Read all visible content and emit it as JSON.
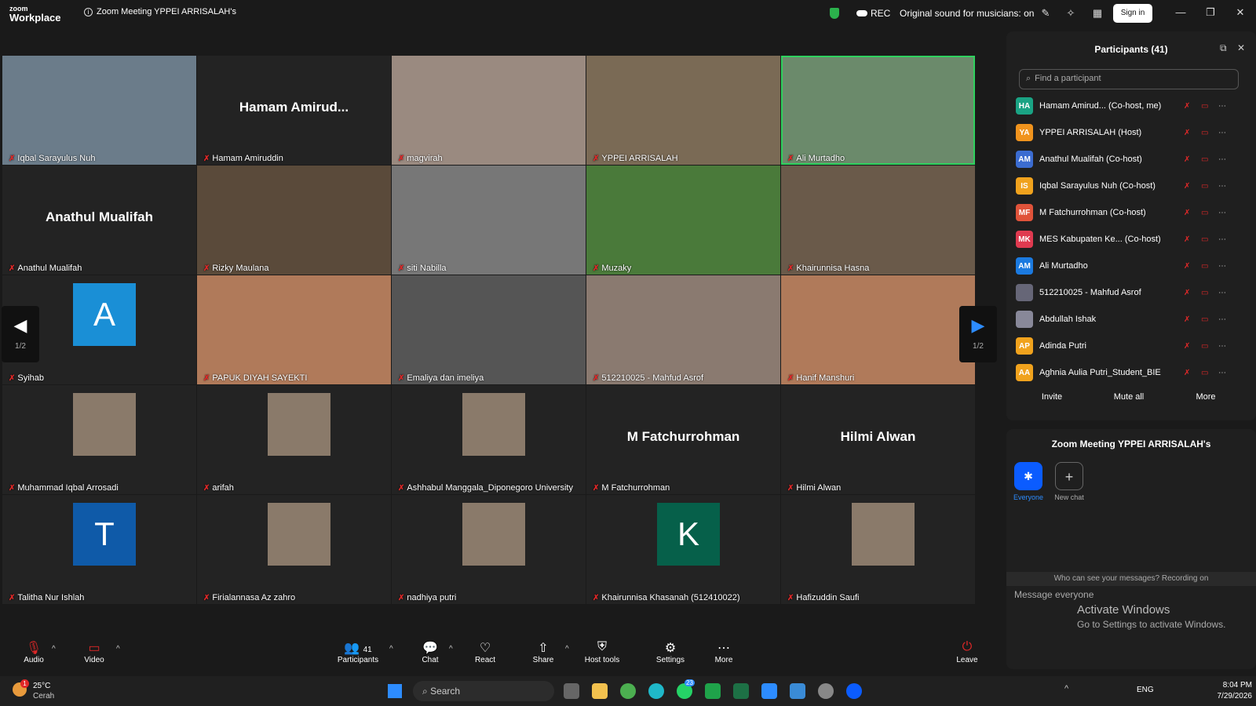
{
  "app": {
    "brand_top": "zoom",
    "brand_bottom": "Workplace",
    "meeting_title": "Zoom Meeting YPPEI ARRISALAH's",
    "rec": "REC",
    "sound": "Original sound for musicians: on",
    "signin": "Sign in"
  },
  "tiles": [
    {
      "name": "Iqbal Sarayulus Nuh",
      "type": "video"
    },
    {
      "name": "Hamam Amiruddin",
      "type": "text",
      "big": "Hamam  Amirud..."
    },
    {
      "name": "magvirah",
      "type": "video"
    },
    {
      "name": "YPPEI ARRISALAH",
      "type": "video"
    },
    {
      "name": "Ali Murtadho",
      "type": "video"
    },
    {
      "name": "Anathul Mualifah",
      "type": "text",
      "big": "Anathul Mualifah"
    },
    {
      "name": "Rizky Maulana",
      "type": "video"
    },
    {
      "name": "siti Nabilla",
      "type": "video"
    },
    {
      "name": "Muzaky",
      "type": "video"
    },
    {
      "name": "Khairunnisa Hasna",
      "type": "video"
    },
    {
      "name": "Syihab",
      "type": "avatar",
      "letter": "A"
    },
    {
      "name": "PAPUK DIYAH SAYEKTI",
      "type": "video"
    },
    {
      "name": "Emaliya dan imeliya",
      "type": "video"
    },
    {
      "name": "512210025 - Mahfud Asrof",
      "type": "video"
    },
    {
      "name": "Hanif Manshuri",
      "type": "video"
    },
    {
      "name": "Muhammad Iqbal Arrosadi",
      "type": "photo"
    },
    {
      "name": "arifah",
      "type": "photo"
    },
    {
      "name": "Ashhabul Manggala_Diponegoro University",
      "type": "photo"
    },
    {
      "name": "M Fatchurrohman",
      "type": "text",
      "big": "M Fatchurrohman"
    },
    {
      "name": "Hilmi Alwan",
      "type": "text",
      "big": "Hilmi Alwan"
    },
    {
      "name": "Talitha Nur Ishlah",
      "type": "avatar",
      "letter": "T"
    },
    {
      "name": "Firialannasa Az zahro",
      "type": "photo"
    },
    {
      "name": "nadhiya putri",
      "type": "photo"
    },
    {
      "name": "Khairunnisa Khasanah (512410022)",
      "type": "avatar",
      "letter": "K"
    },
    {
      "name": "Hafizuddin Saufi",
      "type": "photo"
    }
  ],
  "paging": {
    "left": "1/2",
    "right": "1/2"
  },
  "toolbar": {
    "audio": "Audio",
    "video": "Video",
    "participants": "Participants",
    "participants_count": "41",
    "chat": "Chat",
    "react": "React",
    "share": "Share",
    "host_tools": "Host tools",
    "settings": "Settings",
    "more": "More",
    "leave": "Leave"
  },
  "participants_panel": {
    "title": "Participants (41)",
    "search_placeholder": "Find a participant",
    "list": [
      {
        "initials": "HA",
        "name": "Hamam Amirud...  (Co-host, me)",
        "color": "#1aa384"
      },
      {
        "initials": "YA",
        "name": "YPPEI ARRISALAH (Host)",
        "color": "#f0931d"
      },
      {
        "initials": "AM",
        "name": "Anathul Mualifah (Co-host)",
        "color": "#3b6cd1"
      },
      {
        "initials": "IS",
        "name": "Iqbal Sarayulus Nuh (Co-host)",
        "color": "#f0a21d"
      },
      {
        "initials": "MF",
        "name": "M Fatchurrohman (Co-host)",
        "color": "#e0533a"
      },
      {
        "initials": "MK",
        "name": "MES Kabupaten Ke...  (Co-host)",
        "color": "#e03a50"
      },
      {
        "initials": "AM",
        "name": "Ali Murtadho",
        "color": "#1b7ae0"
      },
      {
        "initials": "",
        "name": "512210025 - Mahfud Asrof",
        "color": "#667"
      },
      {
        "initials": "",
        "name": "Abdullah Ishak",
        "color": "#889"
      },
      {
        "initials": "AP",
        "name": "Adinda Putri",
        "color": "#f0a21d"
      },
      {
        "initials": "AA",
        "name": "Aghnia Aulia Putri_Student_BIE",
        "color": "#f0a21d"
      }
    ],
    "invite": "Invite",
    "mute_all": "Mute all",
    "more": "More"
  },
  "chat_panel": {
    "title": "Zoom Meeting YPPEI ARRISALAH's",
    "everyone": "Everyone",
    "new_chat": "New chat",
    "notice": "Who can see your messages? Recording on",
    "placeholder": "Message everyone",
    "activate1": "Activate Windows",
    "activate2": "Go to Settings to activate Windows."
  },
  "taskbar": {
    "temp": "25°C",
    "weather": "Cerah",
    "search": "Search",
    "lang": "ENG",
    "time": "8:04 PM",
    "date": "7/29/2026",
    "badge": "1",
    "badge2": "23"
  }
}
